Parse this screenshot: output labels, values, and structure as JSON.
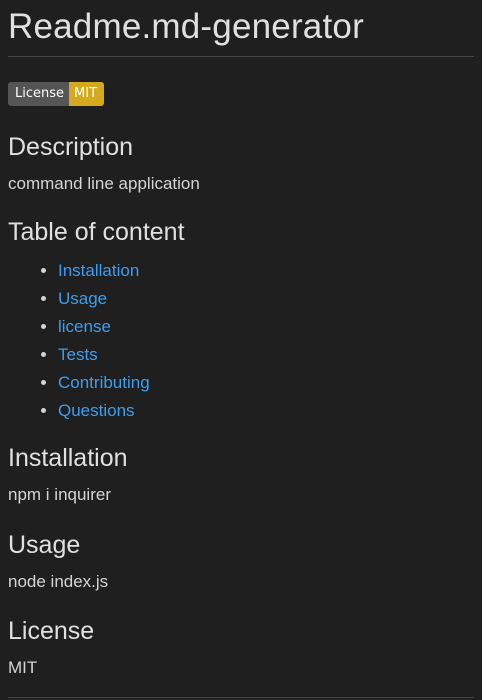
{
  "doc": {
    "title": "Readme.md-generator",
    "badge": {
      "label": "License",
      "value": "MIT",
      "label_color": "#555555",
      "value_color": "#d4a91e"
    },
    "description": {
      "heading": "Description",
      "text": "command line application"
    },
    "toc": {
      "heading": "Table of content",
      "items": [
        {
          "label": "Installation"
        },
        {
          "label": "Usage"
        },
        {
          "label": "license"
        },
        {
          "label": "Tests"
        },
        {
          "label": "Contributing"
        },
        {
          "label": "Questions"
        }
      ]
    },
    "installation": {
      "heading": "Installation",
      "text": "npm i inquirer"
    },
    "usage": {
      "heading": "Usage",
      "text": "node index.js"
    },
    "license": {
      "heading": "License",
      "text": "MIT"
    }
  },
  "theme": {
    "background": "#1f1f1f",
    "text": "#d4d4d4",
    "link": "#3d9ef0"
  }
}
